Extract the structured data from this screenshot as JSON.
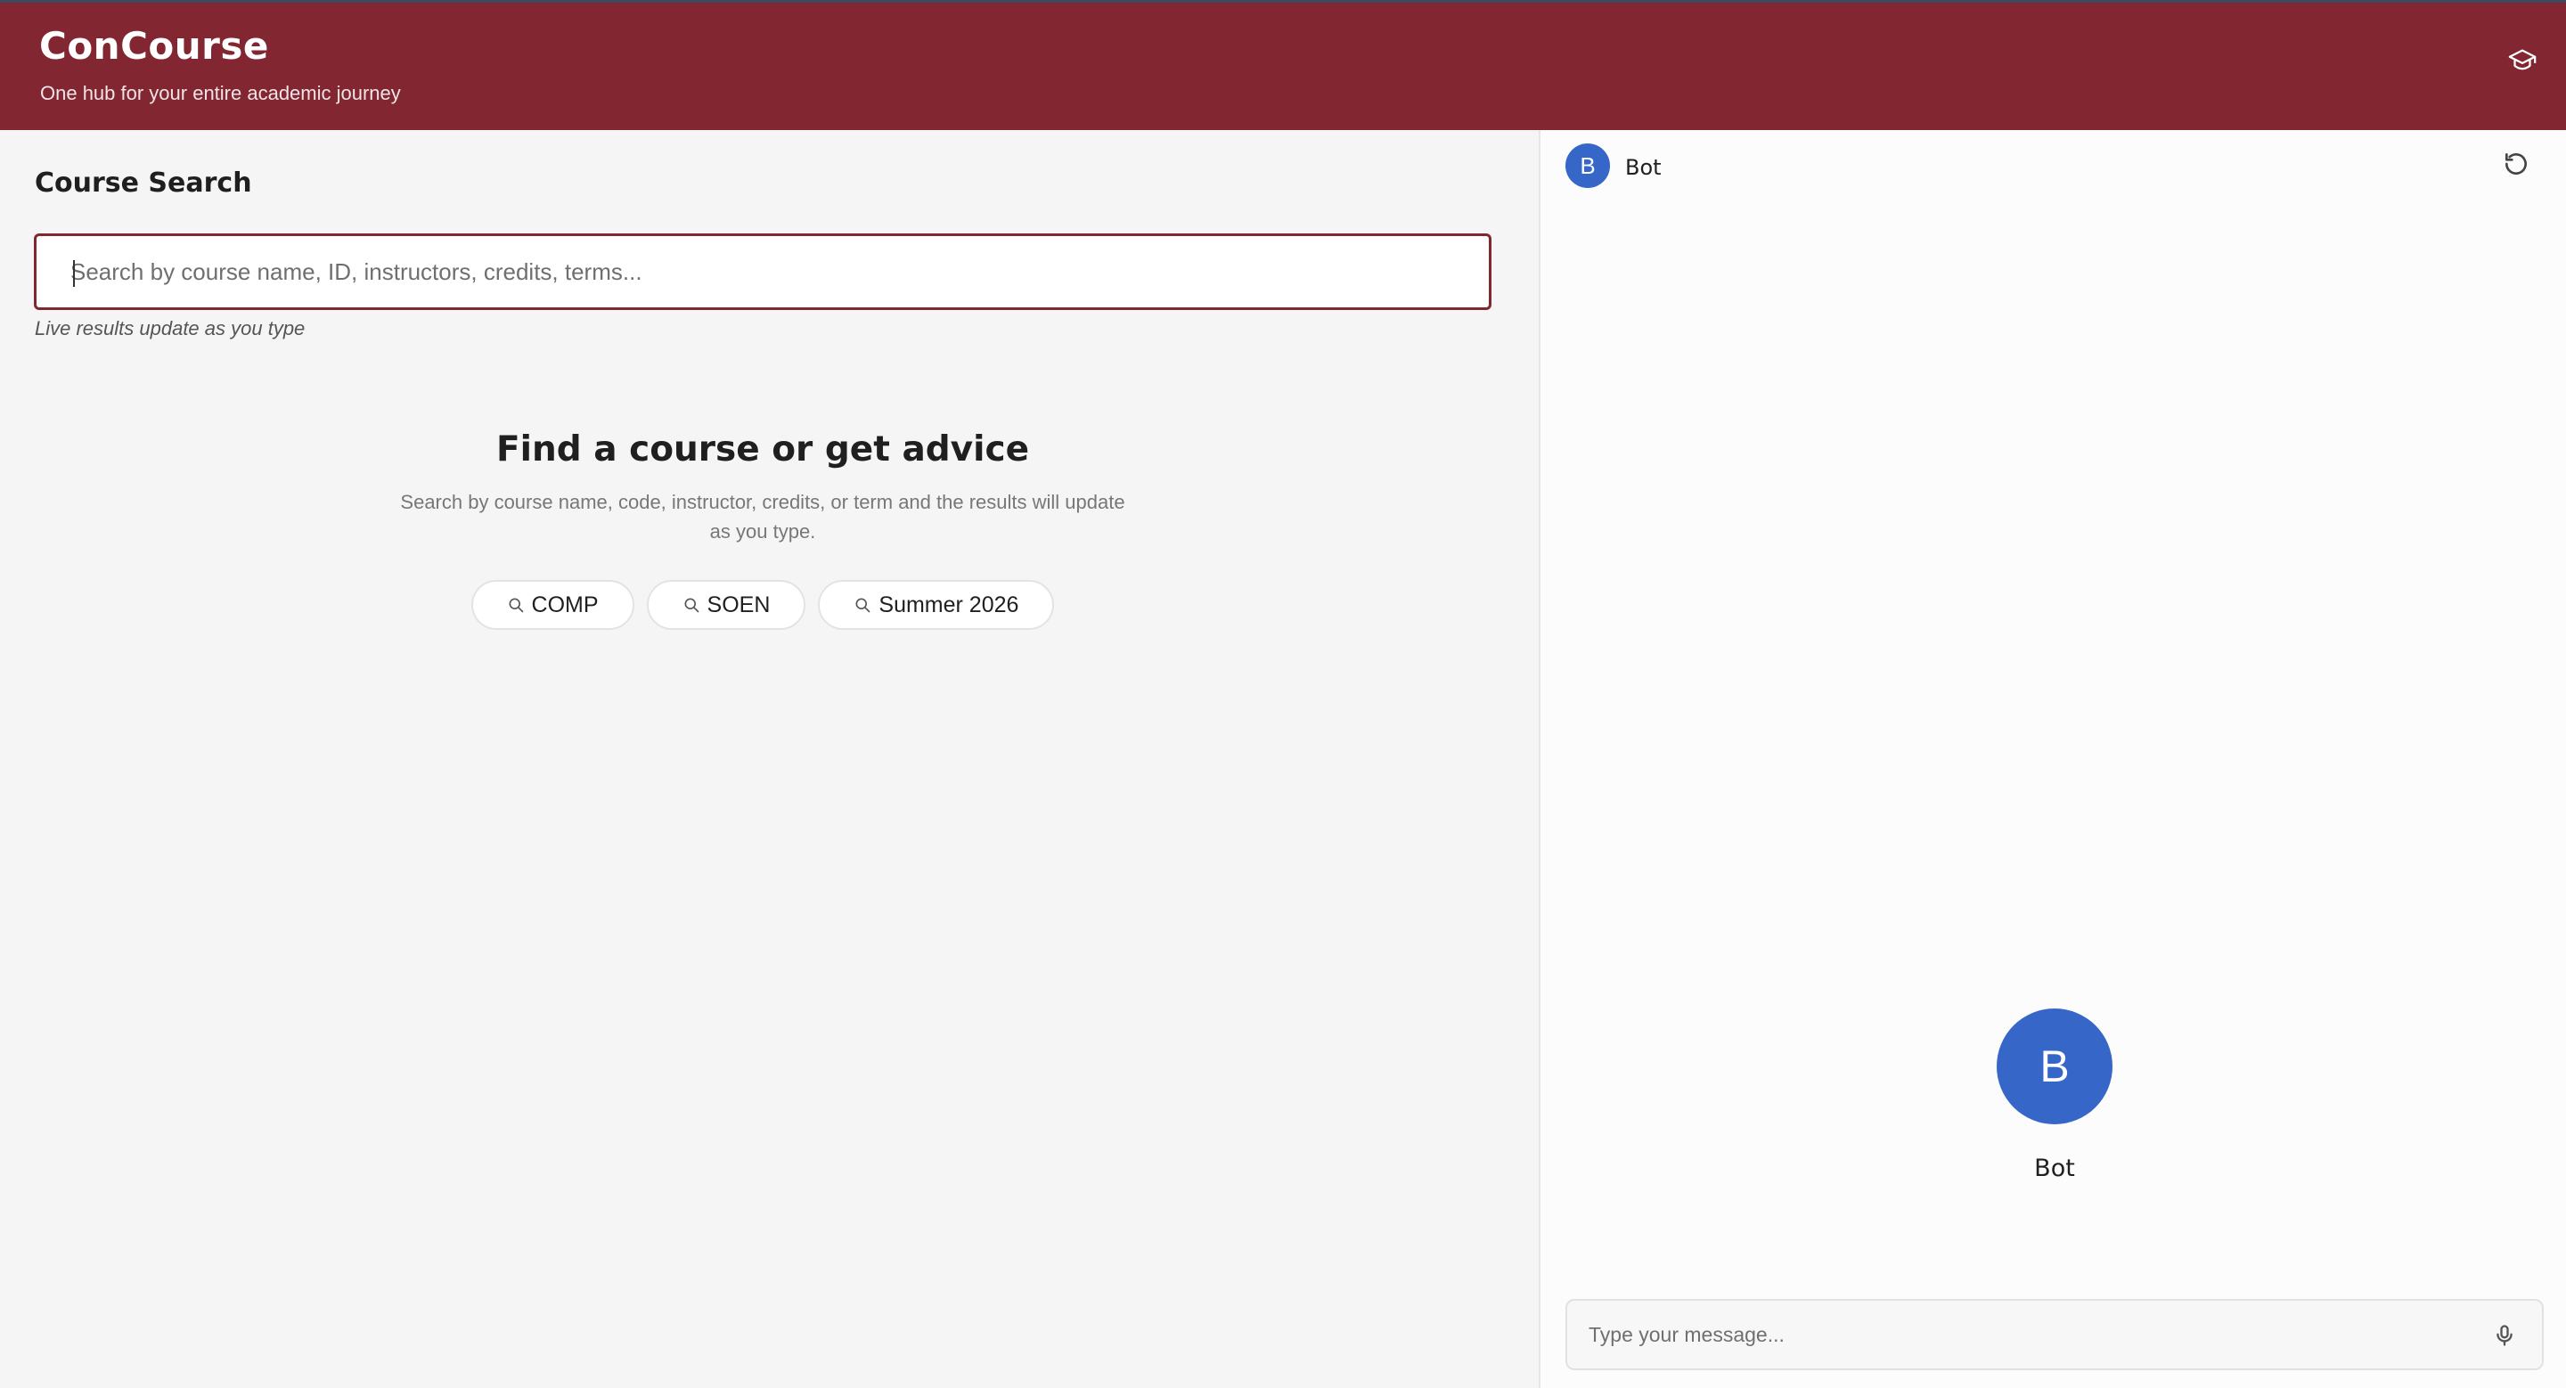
{
  "header": {
    "title": "ConCourse",
    "subtitle": "One hub for your entire academic journey",
    "icon": "graduation-cap-icon"
  },
  "search": {
    "section_title": "Course Search",
    "placeholder": "Search by course name, ID, instructors, credits, terms...",
    "value": "",
    "hint": "Live results update as you type"
  },
  "empty_state": {
    "title": "Find a course or get advice",
    "description": "Search by course name, code, instructor, credits, or term and the results will update as you type.",
    "chips": [
      {
        "label": "COMP",
        "icon": "search-icon"
      },
      {
        "label": "SOEN",
        "icon": "search-icon"
      },
      {
        "label": "Summer 2026",
        "icon": "search-icon"
      }
    ]
  },
  "chat": {
    "bot_initial": "B",
    "bot_name": "Bot",
    "reset_icon": "refresh-icon",
    "message_placeholder": "Type your message...",
    "mic_icon": "microphone-icon"
  },
  "colors": {
    "brand": "#822632",
    "avatar": "#3566c8",
    "background": "#f5f5f5"
  }
}
